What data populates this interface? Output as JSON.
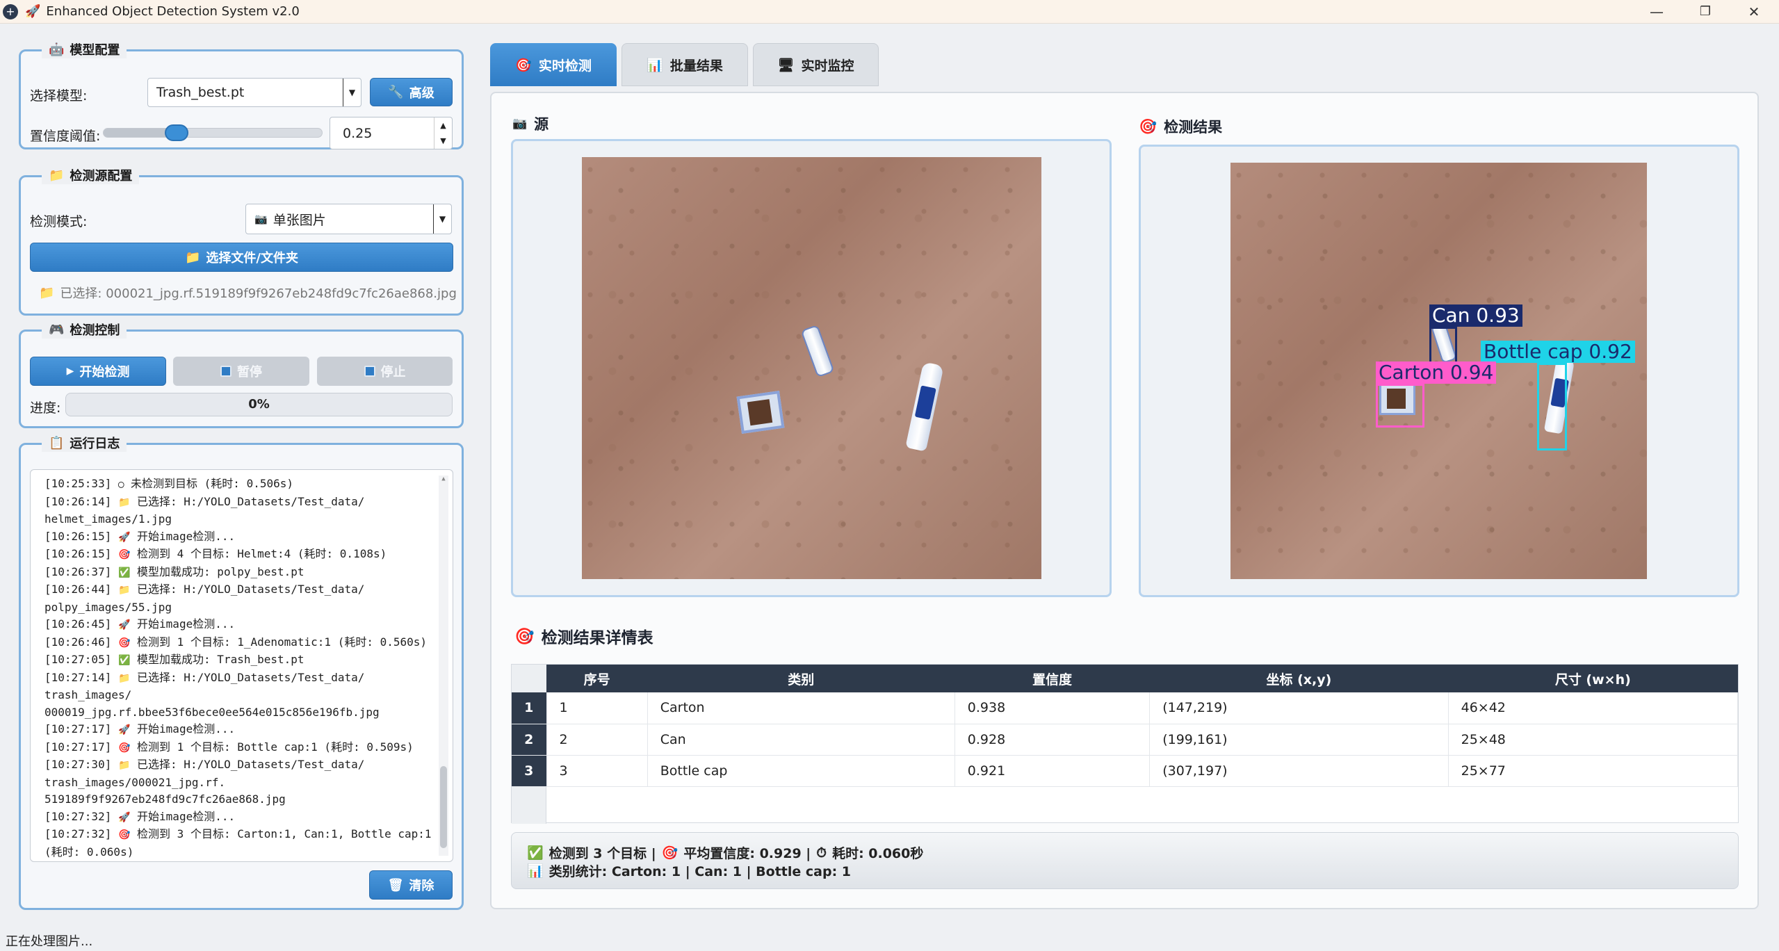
{
  "window": {
    "title": "Enhanced Object Detection System v2.0",
    "minimize": "—",
    "maximize": "❐",
    "close": "✕"
  },
  "model_config": {
    "group_title": "模型配置",
    "model_label": "选择模型:",
    "model_value": "Trash_best.pt",
    "advanced_button": "高级",
    "confidence_label": "置信度阈值:",
    "confidence_value": "0.25",
    "confidence_slider_level": 0.25
  },
  "source_config": {
    "group_title": "检测源配置",
    "mode_label": "检测模式:",
    "mode_value": "单张图片",
    "select_button": "选择文件/文件夹",
    "selected_file": "已选择: 000021_jpg.rf.519189f9f9267eb248fd9c7fc26ae868.jpg"
  },
  "detection_control": {
    "group_title": "检测控制",
    "start_button": "开始检测",
    "pause_button": "暂停",
    "stop_button": "停止",
    "progress_label": "进度:",
    "progress_text": "0%",
    "progress_value": 0
  },
  "log": {
    "group_title": "运行日志",
    "clear_button": "清除",
    "lines": [
      {
        "icon": "empty-circle-icon",
        "glyph": "◯",
        "text": "[10:25:33]  未检测到目标 (耗时: 0.506s)"
      },
      {
        "icon": "folder-icon",
        "glyph": "📁",
        "text": "[10:26:14]  已选择: H:/YOLO_Datasets/Test_data/"
      },
      {
        "icon": "",
        "glyph": "",
        "text": "helmet_images/1.jpg"
      },
      {
        "icon": "rocket-icon",
        "glyph": "🚀",
        "text": "[10:26:15]  开始image检测..."
      },
      {
        "icon": "target-icon",
        "glyph": "🎯",
        "text": "[10:26:15]  检测到 4 个目标: Helmet:4 (耗时: 0.108s)"
      },
      {
        "icon": "check-icon",
        "glyph": "✅",
        "text": "[10:26:37]  模型加载成功: polpy_best.pt"
      },
      {
        "icon": "folder-icon",
        "glyph": "📁",
        "text": "[10:26:44]  已选择: H:/YOLO_Datasets/Test_data/"
      },
      {
        "icon": "",
        "glyph": "",
        "text": "polpy_images/55.jpg"
      },
      {
        "icon": "rocket-icon",
        "glyph": "🚀",
        "text": "[10:26:45]  开始image检测..."
      },
      {
        "icon": "target-icon",
        "glyph": "🎯",
        "text": "[10:26:46]  检测到 1 个目标: 1_Adenomatic:1 (耗时: 0.560s)"
      },
      {
        "icon": "check-icon",
        "glyph": "✅",
        "text": "[10:27:05]  模型加载成功: Trash_best.pt"
      },
      {
        "icon": "folder-icon",
        "glyph": "📁",
        "text": "[10:27:14]  已选择: H:/YOLO_Datasets/Test_data/"
      },
      {
        "icon": "",
        "glyph": "",
        "text": "trash_images/"
      },
      {
        "icon": "",
        "glyph": "",
        "text": "000019_jpg.rf.bbee53f6bece0ee564e015c856e196fb.jpg"
      },
      {
        "icon": "rocket-icon",
        "glyph": "🚀",
        "text": "[10:27:17]  开始image检测..."
      },
      {
        "icon": "target-icon",
        "glyph": "🎯",
        "text": "[10:27:17]  检测到 1 个目标: Bottle cap:1 (耗时: 0.509s)"
      },
      {
        "icon": "folder-icon",
        "glyph": "📁",
        "text": "[10:27:30]  已选择: H:/YOLO_Datasets/Test_data/"
      },
      {
        "icon": "",
        "glyph": "",
        "text": "trash_images/000021_jpg.rf."
      },
      {
        "icon": "",
        "glyph": "",
        "text": "519189f9f9267eb248fd9c7fc26ae868.jpg"
      },
      {
        "icon": "rocket-icon",
        "glyph": "🚀",
        "text": "[10:27:32]  开始image检测..."
      },
      {
        "icon": "target-icon",
        "glyph": "🎯",
        "text": "[10:27:32]  检测到 3 个目标: Carton:1, Can:1, Bottle cap:1"
      },
      {
        "icon": "",
        "glyph": "",
        "text": "(耗时: 0.060s)"
      }
    ]
  },
  "tabs": [
    {
      "label": "实时检测",
      "icon": "target-icon",
      "active": true
    },
    {
      "label": "批量结果",
      "icon": "bar-chart-icon",
      "active": false
    },
    {
      "label": "实时监控",
      "icon": "monitor-icon",
      "active": false
    }
  ],
  "source_panel": {
    "title": "源"
  },
  "result_panel": {
    "title": "检测结果",
    "detections": [
      {
        "label": "Can 0.93",
        "color": "#1a2a6c"
      },
      {
        "label": "Bottle cap 0.92",
        "color": "#1fd3e8"
      },
      {
        "label": "Carton 0.94",
        "color": "#ff5ccb"
      }
    ]
  },
  "details": {
    "title": "检测结果详情表",
    "columns": [
      "序号",
      "类别",
      "置信度",
      "坐标 (x,y)",
      "尺寸 (w×h)"
    ],
    "rows": [
      {
        "idx": "1",
        "no": "1",
        "cls": "Carton",
        "conf": "0.938",
        "coord": "(147,219)",
        "size": "46×42"
      },
      {
        "idx": "2",
        "no": "2",
        "cls": "Can",
        "conf": "0.928",
        "coord": "(199,161)",
        "size": "25×48"
      },
      {
        "idx": "3",
        "no": "3",
        "cls": "Bottle cap",
        "conf": "0.921",
        "coord": "(307,197)",
        "size": "25×77"
      }
    ]
  },
  "summary": {
    "detected": "检测到 3 个目标 |",
    "avg_conf": "平均置信度: 0.929 |",
    "time": "耗时: 0.060秒",
    "stats": "类别统计: Carton: 1 | Can: 1 | Bottle cap: 1"
  },
  "status": "正在处理图片...",
  "colors": {
    "accent": "#2f7cc5",
    "group_border": "#7fb1de",
    "table_header": "#2e3a4b"
  }
}
